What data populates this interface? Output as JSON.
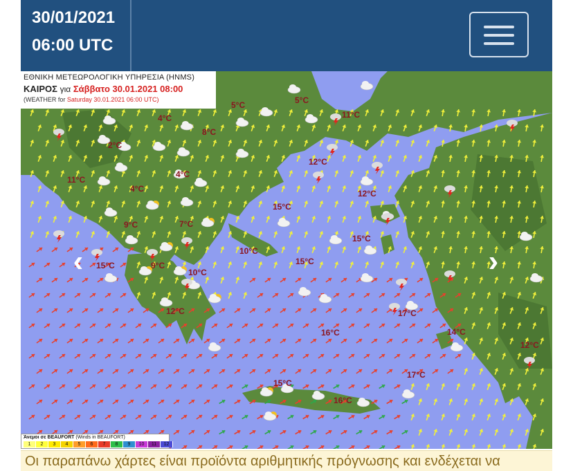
{
  "header": {
    "date": "30/01/2021",
    "time": "06:00 UTC"
  },
  "map": {
    "title_line1": "ΕΘΝΙΚΗ ΜΕΤΕΩΡΟΛΟΓΙΚΗ ΥΠΗΡΕΣΙΑ (HNMS)",
    "title_line2_prefix": "ΚΑΙΡΟΣ",
    "title_line2_mid": "για",
    "title_line2_date": "Σάββατο 30.01.2021 08:00",
    "title_line3_prefix": "(WEATHER for",
    "title_line3_date": "Saturday 30.01.2021 06:00 UTC)",
    "temperatures": [
      "5°C",
      "5°C",
      "11°C",
      "4°C",
      "8°C",
      "2°C",
      "12°C",
      "4°C",
      "11°C",
      "4°C",
      "15°C",
      "12°C",
      "9°C",
      "7°C",
      "15°C",
      "10°C",
      "15°C",
      "15°C",
      "9°C",
      "10°C",
      "12°C",
      "17°C",
      "16°C",
      "14°C",
      "12°C",
      "17°C",
      "15°C",
      "16°C"
    ],
    "legend_title": "Άνεμοι σε BEAUFORT",
    "legend_subtitle": "(Winds in BEAUFORT)",
    "beaufort_scale": [
      "1",
      "2",
      "3",
      "4",
      "5",
      "6",
      "7",
      "8",
      "9",
      "10",
      "11",
      "12"
    ],
    "beaufort_colors": [
      "#ffff7a",
      "#ffff3c",
      "#ffea00",
      "#f5d400",
      "#ff9d2a",
      "#ff6a1c",
      "#e83a2a",
      "#2fbf4a",
      "#2f8fd0",
      "#c83ad8",
      "#8b1fa0",
      "#4b4bd6"
    ],
    "colors": {
      "sea": "#8f9df0",
      "land": "#5b8a3c",
      "arrow_yellow": "#f1f03b",
      "arrow_red": "#e8402c",
      "arrow_green": "#2fa84a"
    },
    "prev_icon": "chevron-left-icon",
    "next_icon": "chevron-right-icon"
  },
  "footer": {
    "text": "Οι παραπάνω χάρτες είναι προϊόντα αριθμητικής πρόγνωσης και ενδέχεται να"
  },
  "menu_icon": "hamburger-menu-icon"
}
